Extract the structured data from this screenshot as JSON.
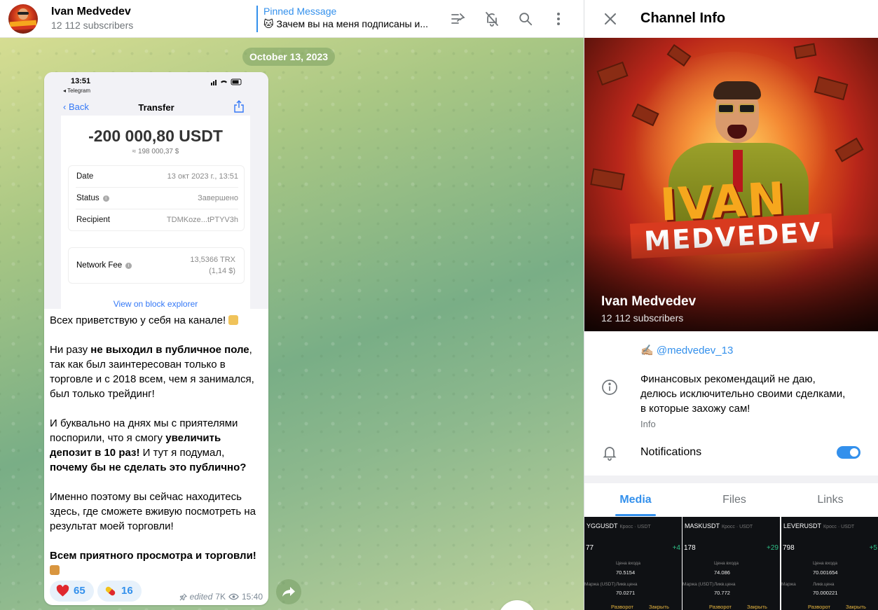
{
  "chat_header": {
    "title": "Ivan Medvedev",
    "subscribers": "12 112 subscribers",
    "pinned_label": "Pinned Message",
    "pinned_text": "🐱 Зачем вы на меня подписаны и..."
  },
  "date_separator": "October 13, 2023",
  "message": {
    "screenshot": {
      "status_time": "13:51",
      "source_app": "◂ Telegram",
      "back_label": "Back",
      "title": "Transfer",
      "amount": "-200 000,80 USDT",
      "approx": "≈ 198 000,37 $",
      "rows": [
        {
          "key": "Date",
          "value": "13 окт 2023 г., 13:51"
        },
        {
          "key": "Status",
          "value": "Завершено"
        },
        {
          "key": "Recipient",
          "value": "TDMKoze...tPTYV3h"
        }
      ],
      "fee_label": "Network Fee",
      "fee_value_1": "13,5366 TRX",
      "fee_value_2": "(1,14 $)",
      "explorer_link": "View on block explorer"
    },
    "text": {
      "p1": "Всех приветствую у себя на канале!",
      "p2_a": "Ни разу ",
      "p2_b": "не выходил в публичное поле",
      "p2_c": ", так как был заинтересован только в торговле и с 2018 всем, чем я занимался, был только трейдинг!",
      "p3_a": "И буквально на днях мы с приятелями поспорили, что я смогу ",
      "p3_b": "увеличить депозит в 10 раз!",
      "p3_c": " И тут я подумал, ",
      "p3_d": "почему бы не сделать это публично?",
      "p4": "Именно поэтому вы сейчас находитесь здесь, где сможете вживую посмотреть на результат моей торговли!",
      "p5": "Всем приятного просмотра и торговли!"
    },
    "reactions": [
      {
        "icon": "heart",
        "count": "65"
      },
      {
        "icon": "pill",
        "count": "16"
      }
    ],
    "meta": {
      "edited": "edited",
      "views": "7K",
      "time": "15:40"
    }
  },
  "channel_info": {
    "title": "Channel Info",
    "cover_word_1": "IVAN",
    "cover_word_2": "MEDVEDEV",
    "name": "Ivan Medvedev",
    "subscribers": "12 112 subscribers",
    "username": "✍🏼 @medvedev_13",
    "description": "Финансовых рекомендаций не даю, делюсь исключительно своими сделками, в которые захожу сам!",
    "description_label": "Info",
    "notifications_label": "Notifications",
    "notifications_on": true,
    "tabs": [
      "Media",
      "Files",
      "Links"
    ],
    "active_tab": "Media",
    "media": [
      {
        "ticker": "YGGUSDT",
        "tag": "Кросс · USDT",
        "big": "77",
        "pos": "+4",
        "entry_label": "Цена входа",
        "entry": "70.5154",
        "liq_label": "Ликв.цена",
        "liq": "70.0271",
        "margin_label": "Маржа (USDT)",
        "btn1": "Разворот",
        "btn2": "Закрыть"
      },
      {
        "ticker": "MASKUSDT",
        "tag": "Кросс · USDT",
        "big": "178",
        "pos": "+29",
        "entry_label": "Цена входа",
        "entry": "74.086",
        "liq_label": "Ликв.цена",
        "liq": "70.772",
        "margin_label": "Маржа (USDT)",
        "btn1": "Разворот",
        "btn2": "Закрыть"
      },
      {
        "ticker": "LEVERUSDT",
        "tag": "Кросс · USDT",
        "big": "798",
        "pos": "+5",
        "entry_label": "Цена входа",
        "entry": "70.001654",
        "liq_label": "Ликв.цена",
        "liq": "70.000221",
        "margin_label": "Маржа",
        "btn1": "Разворот",
        "btn2": "Закрыть"
      }
    ]
  },
  "colors": {
    "accent": "#3390ec",
    "reaction_bg": "#e7f1fb",
    "muted": "#707579"
  }
}
